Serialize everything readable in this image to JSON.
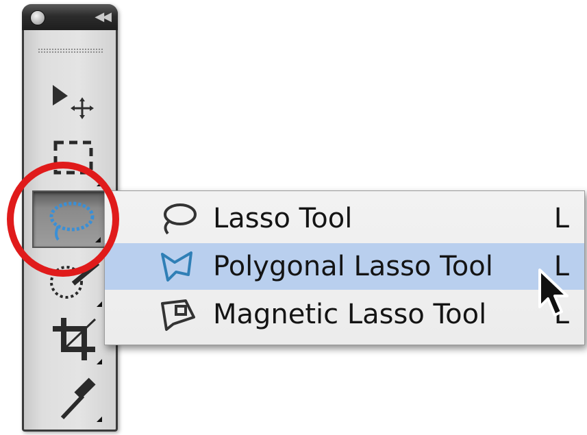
{
  "toolbar": {
    "tools": [
      {
        "name": "move-tool",
        "icon": "move-arrow-icon"
      },
      {
        "name": "marquee-tool",
        "icon": "rect-marquee-icon"
      },
      {
        "name": "lasso-tool",
        "icon": "lasso-icon",
        "active": true
      },
      {
        "name": "quick-selection-tool",
        "icon": "quick-selection-icon"
      },
      {
        "name": "crop-tool",
        "icon": "crop-icon"
      },
      {
        "name": "eyedropper-tool",
        "icon": "eyedropper-icon"
      }
    ]
  },
  "annotation": {
    "color": "#e01b1b"
  },
  "flyout": {
    "items": [
      {
        "label": "Lasso Tool",
        "shortcut": "L",
        "icon": "lasso-icon",
        "selected": false
      },
      {
        "label": "Polygonal Lasso Tool",
        "shortcut": "L",
        "icon": "polygonal-lasso-icon",
        "selected": true
      },
      {
        "label": "Magnetic Lasso Tool",
        "shortcut": "L",
        "icon": "magnetic-lasso-icon",
        "selected": false
      }
    ],
    "highlight_color": "#b9cfee"
  }
}
